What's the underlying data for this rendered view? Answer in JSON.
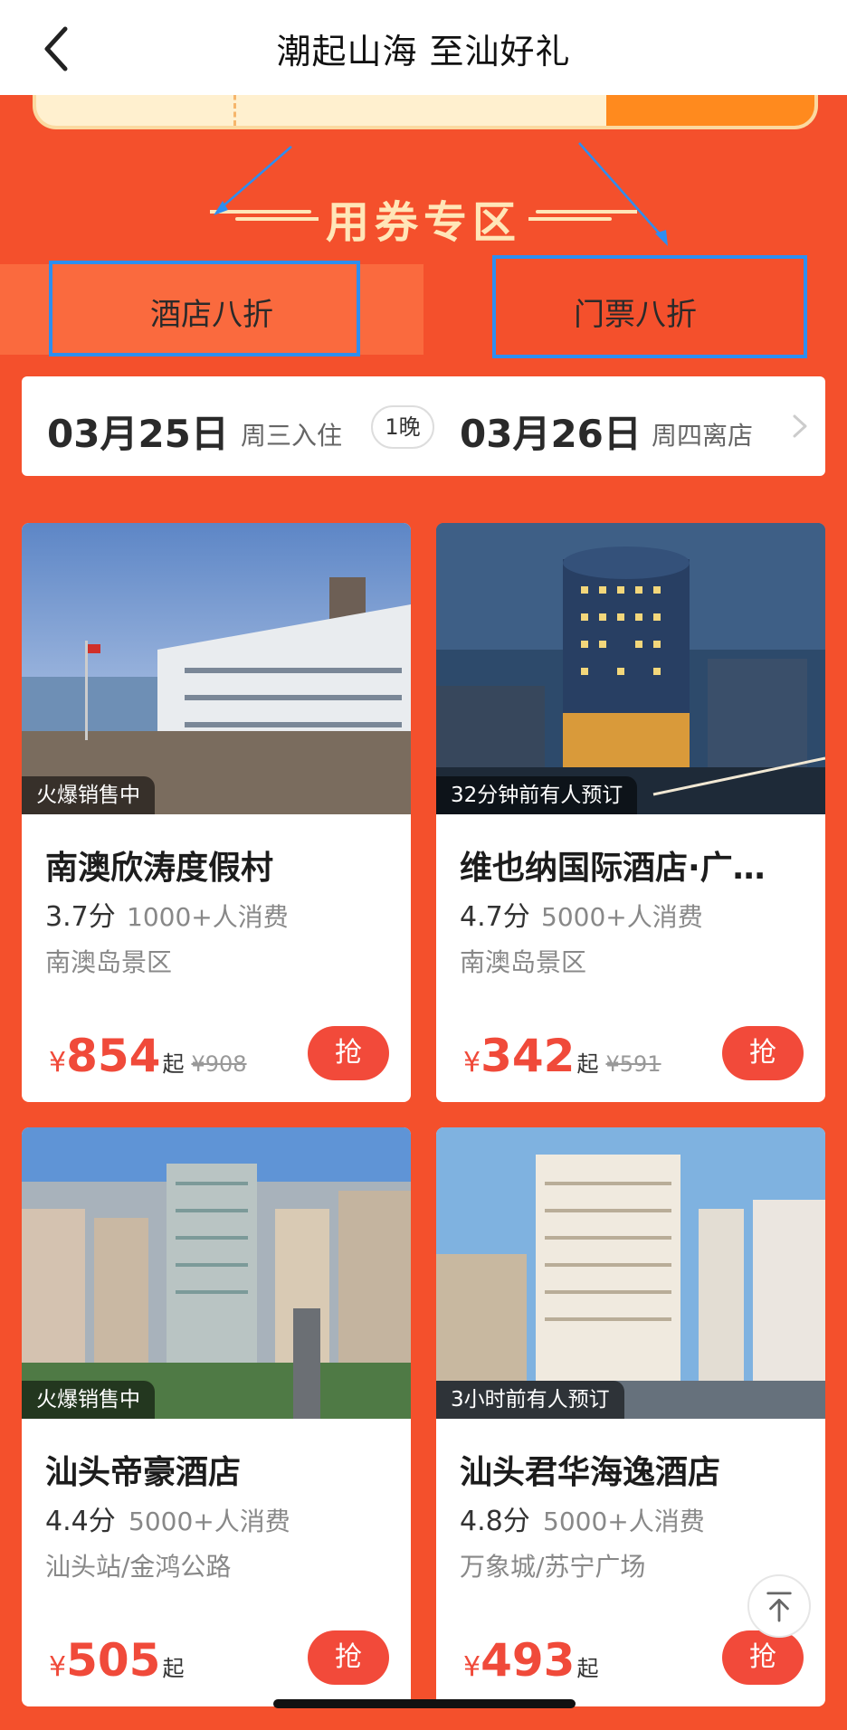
{
  "header": {
    "title": "潮起山海 至汕好礼",
    "back_icon": "chevron-left-icon"
  },
  "section": {
    "title": "用券专区"
  },
  "tabs": [
    {
      "label": "酒店八折",
      "selected": true
    },
    {
      "label": "门票八折",
      "selected": false
    }
  ],
  "dates": {
    "checkin_date": "03月25日",
    "checkin_label": "周三入住",
    "nights": "1晚",
    "checkout_date": "03月26日",
    "checkout_label": "周四离店"
  },
  "hotels": [
    {
      "tag": "火爆销售中",
      "name": "南澳欣涛度假村",
      "score": "3.7分",
      "consume": "1000+人消费",
      "area": "南澳岛景区",
      "currency": "¥",
      "price": "854",
      "suffix": "起",
      "original": "¥908",
      "button": "抢"
    },
    {
      "tag": "32分钟前有人预订",
      "name": "维也纳国际酒店·广…",
      "score": "4.7分",
      "consume": "5000+人消费",
      "area": "南澳岛景区",
      "currency": "¥",
      "price": "342",
      "suffix": "起",
      "original": "¥591",
      "button": "抢"
    },
    {
      "tag": "火爆销售中",
      "name": "汕头帝豪酒店",
      "score": "4.4分",
      "consume": "5000+人消费",
      "area": "汕头站/金鸿公路",
      "currency": "¥",
      "price": "505",
      "suffix": "起",
      "original": "",
      "button": "抢"
    },
    {
      "tag": "3小时前有人预订",
      "name": "汕头君华海逸酒店",
      "score": "4.8分",
      "consume": "5000+人消费",
      "area": "万象城/苏宁广场",
      "currency": "¥",
      "price": "493",
      "suffix": "起",
      "original": "",
      "button": "抢"
    }
  ],
  "floating": {
    "back_to_top_icon": "arrow-up-to-top-icon"
  },
  "colors": {
    "page_bg": "#f4502c",
    "accent": "#f04a3a",
    "highlight_border": "#2d8ef0"
  }
}
